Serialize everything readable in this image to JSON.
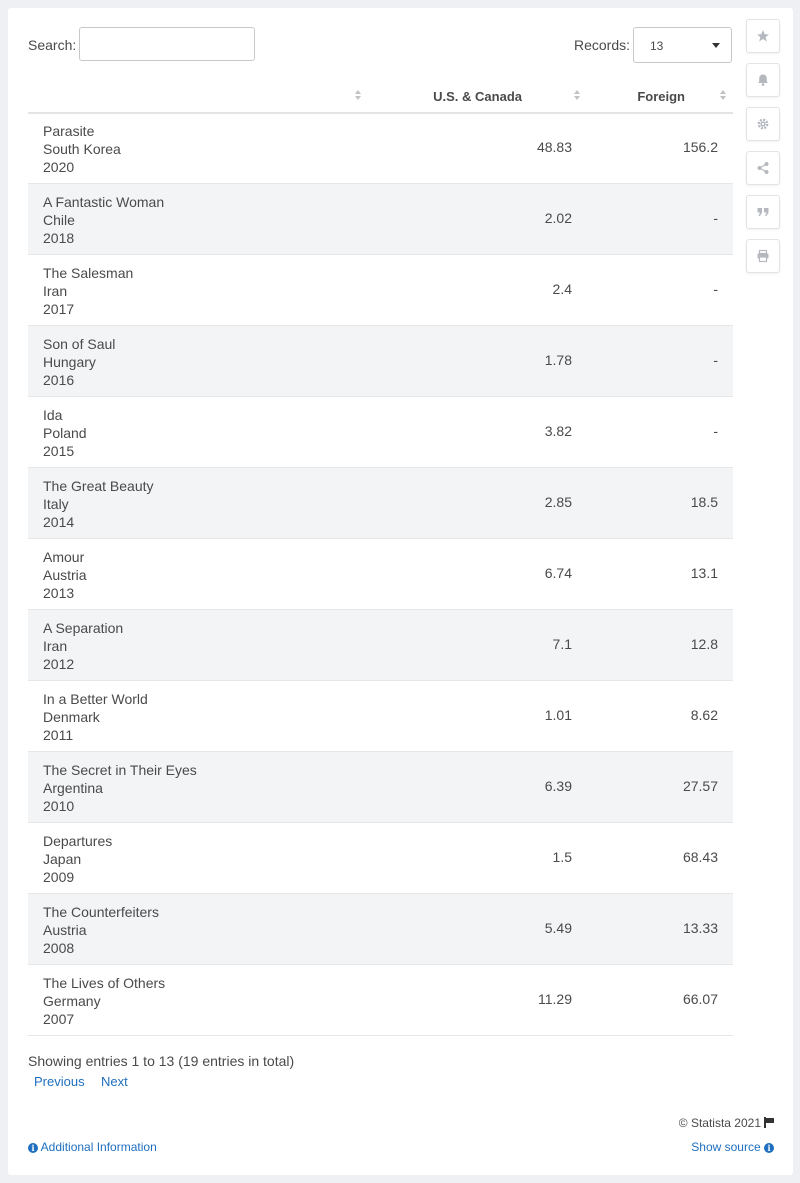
{
  "search": {
    "label": "Search:",
    "value": ""
  },
  "records": {
    "label": "Records:",
    "selected": "13"
  },
  "table": {
    "columns": [
      "",
      "U.S. & Canada",
      "Foreign"
    ],
    "rows": [
      {
        "title": "Parasite",
        "country": "South Korea",
        "year": "2020",
        "us": "48.83",
        "foreign": "156.2"
      },
      {
        "title": "A Fantastic Woman",
        "country": "Chile",
        "year": "2018",
        "us": "2.02",
        "foreign": "-"
      },
      {
        "title": "The Salesman",
        "country": "Iran",
        "year": "2017",
        "us": "2.4",
        "foreign": "-"
      },
      {
        "title": "Son of Saul",
        "country": "Hungary",
        "year": "2016",
        "us": "1.78",
        "foreign": "-"
      },
      {
        "title": "Ida",
        "country": "Poland",
        "year": "2015",
        "us": "3.82",
        "foreign": "-"
      },
      {
        "title": "The Great Beauty",
        "country": "Italy",
        "year": "2014",
        "us": "2.85",
        "foreign": "18.5"
      },
      {
        "title": "Amour",
        "country": "Austria",
        "year": "2013",
        "us": "6.74",
        "foreign": "13.1"
      },
      {
        "title": "A Separation",
        "country": "Iran",
        "year": "2012",
        "us": "7.1",
        "foreign": "12.8"
      },
      {
        "title": "In a Better World",
        "country": "Denmark",
        "year": "2011",
        "us": "1.01",
        "foreign": "8.62"
      },
      {
        "title": "The Secret in Their Eyes",
        "country": "Argentina",
        "year": "2010",
        "us": "6.39",
        "foreign": "27.57"
      },
      {
        "title": "Departures",
        "country": "Japan",
        "year": "2009",
        "us": "1.5",
        "foreign": "68.43"
      },
      {
        "title": "The Counterfeiters",
        "country": "Austria",
        "year": "2008",
        "us": "5.49",
        "foreign": "13.33"
      },
      {
        "title": "The Lives of Others",
        "country": "Germany",
        "year": "2007",
        "us": "11.29",
        "foreign": "66.07"
      }
    ]
  },
  "footer": {
    "showing": "Showing entries 1 to 13 (19 entries in total)",
    "previous": "Previous",
    "next": "Next",
    "copyright": "© Statista 2021",
    "additional_info": "Additional Information",
    "show_source": "Show source"
  },
  "sidebar_icons": [
    "star-icon",
    "bell-icon",
    "gear-icon",
    "share-icon",
    "quote-icon",
    "print-icon"
  ],
  "colors": {
    "link": "#1f6fbf",
    "row_alt": "#f3f4f6",
    "icon_gray": "#b5b9bf"
  }
}
